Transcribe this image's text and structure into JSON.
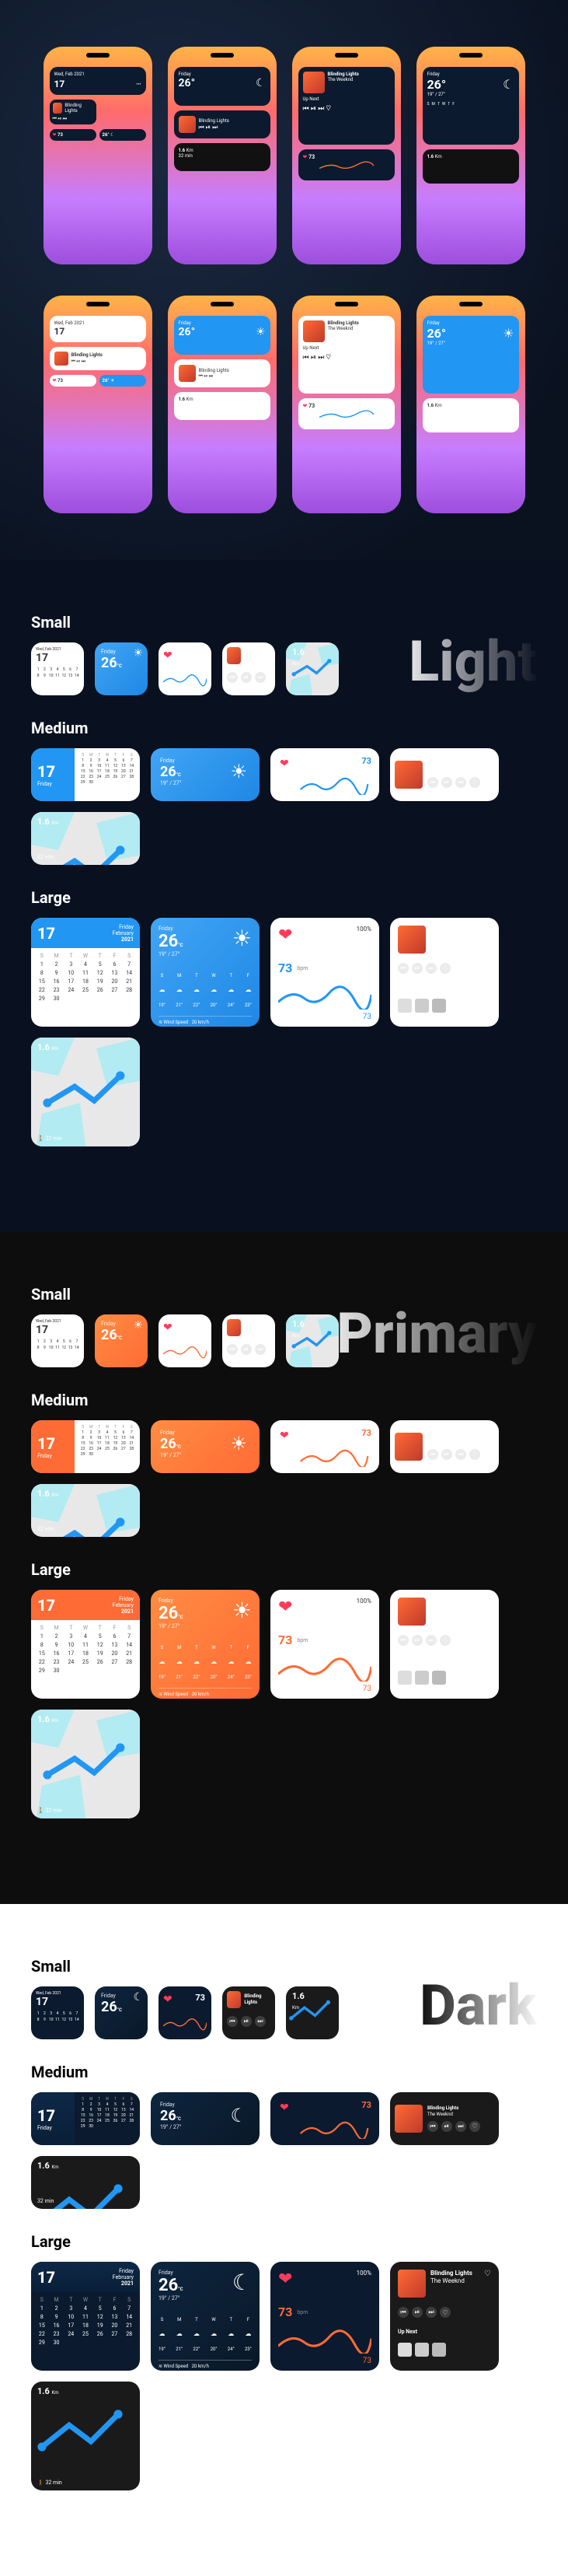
{
  "hero": {
    "rows": [
      {
        "theme": "dark",
        "phones": 4
      },
      {
        "theme": "light",
        "phones": 4
      }
    ]
  },
  "themes": [
    {
      "key": "light",
      "title": "Light",
      "accent": "#2196f3",
      "accent_class": "accent-light",
      "weather_class": "wthr-light",
      "widget_dark": false
    },
    {
      "key": "primary",
      "title": "Primary",
      "accent": "#ff6b35",
      "accent_class": "accent-primary",
      "weather_class": "wthr-primary",
      "widget_dark": false
    },
    {
      "key": "dark",
      "title": "Dark",
      "accent": "#1565c0",
      "accent_class": "accent-dark",
      "weather_class": "wthr-dark",
      "widget_dark": true
    }
  ],
  "sizes": [
    "Small",
    "Medium",
    "Large"
  ],
  "calendar": {
    "weekday_short": "Wed, Feb 2021",
    "date_num": "17",
    "weekday": "Friday",
    "month": "February",
    "year": "2021",
    "days_header": [
      "S",
      "M",
      "T",
      "W",
      "T",
      "F",
      "S"
    ],
    "today": 17,
    "month_days": [
      1,
      2,
      3,
      4,
      5,
      6,
      7,
      8,
      9,
      10,
      11,
      12,
      13,
      14,
      15,
      16,
      17,
      18,
      19,
      20,
      21,
      22,
      23,
      24,
      25,
      26,
      27,
      28,
      29,
      30
    ]
  },
  "weather": {
    "day": "Friday",
    "temp": "26",
    "unit": "°C",
    "range": "19° / 27°",
    "icon": "☀",
    "moon": "☾",
    "forecast": [
      {
        "d": "S",
        "t": "19°"
      },
      {
        "d": "M",
        "t": "21°"
      },
      {
        "d": "T",
        "t": "22°"
      },
      {
        "d": "W",
        "t": "20°"
      },
      {
        "d": "T",
        "t": "24°"
      },
      {
        "d": "F",
        "t": "23°"
      }
    ],
    "wind_label": "Wind Speed",
    "wind_val": "20 km/h"
  },
  "heart": {
    "bpm": "73",
    "unit": "bpm",
    "percent": "100%"
  },
  "music": {
    "track": "Blinding Lights",
    "artist": "The Weeknd",
    "up_next_label": "Up Next",
    "controls": [
      "⏮",
      "⏯",
      "⏭",
      "♡"
    ]
  },
  "map": {
    "distance": "1.6",
    "unit": "Km",
    "time": "32 min"
  }
}
